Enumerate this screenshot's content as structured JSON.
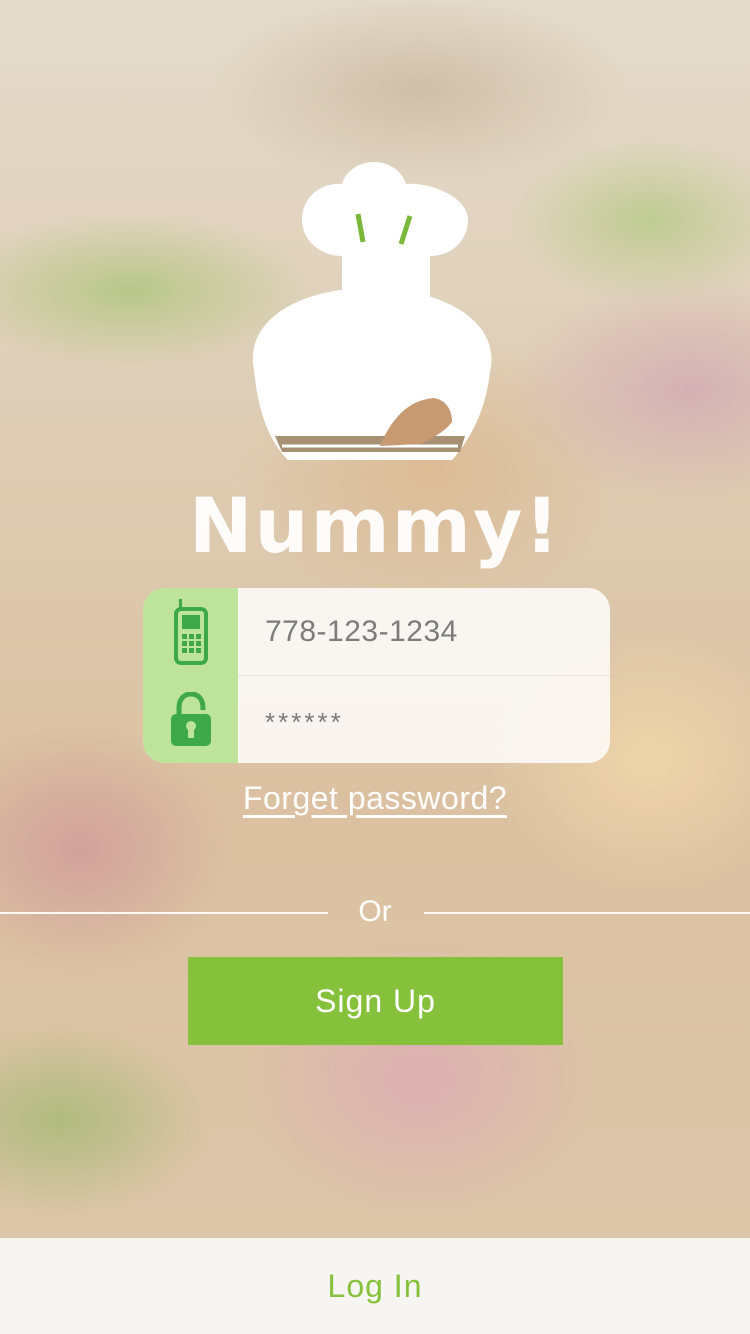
{
  "app": {
    "brand_name": "Nummy!"
  },
  "login_form": {
    "phone_value": "778-123-1234",
    "password_value": "******",
    "phone_icon": "mobile-phone-icon",
    "password_icon": "padlock-icon"
  },
  "links": {
    "forget_password": "Forget password?"
  },
  "separator": {
    "or_label": "Or"
  },
  "actions": {
    "sign_up_label": "Sign Up",
    "log_in_label": "Log In"
  },
  "colors": {
    "accent_green": "#86c13b",
    "icon_cell_green": "#bde49a"
  }
}
